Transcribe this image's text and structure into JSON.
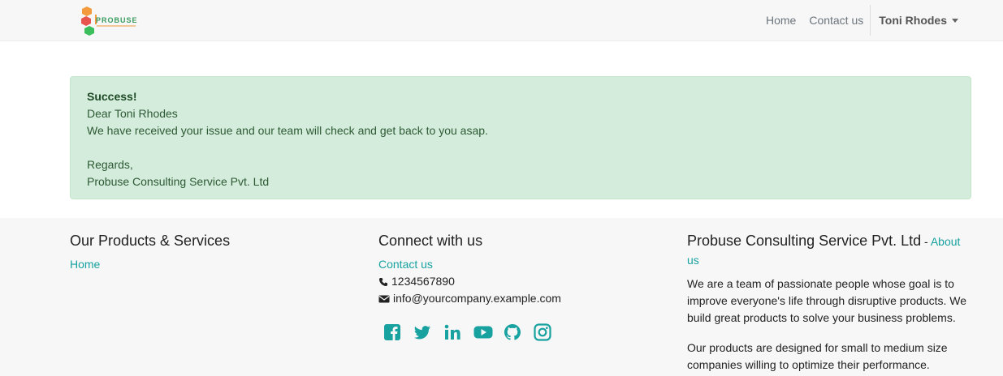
{
  "nav": {
    "brand": "PROBUSE",
    "home": "Home",
    "contact": "Contact us",
    "user": "Toni Rhodes"
  },
  "alert": {
    "title": "Success!",
    "greeting": "Dear Toni Rhodes",
    "message": "We have received your issue and our team will check and get back to you asap.",
    "regards": "Regards,",
    "company": "Probuse Consulting Service Pvt. Ltd"
  },
  "footer": {
    "products_title": "Our Products & Services",
    "products_home": "Home",
    "connect_title": "Connect with us",
    "contact_link": "Contact us",
    "phone": "1234567890",
    "email": "info@yourcompany.example.com",
    "social_icons": [
      "facebook-icon",
      "twitter-icon",
      "linkedin-icon",
      "youtube-icon",
      "github-icon",
      "instagram-icon"
    ],
    "about_company": "Probuse Consulting Service Pvt. Ltd",
    "about_sep": " - ",
    "about_link": "About us",
    "about_p1": "We are a team of passionate people whose goal is to improve everyone's life through disruptive products. We build great products to solve your business problems.",
    "about_p2": "Our products are designed for small to medium size companies willing to optimize their performance."
  },
  "colors": {
    "accent": "#17a2a0",
    "alert_bg": "#d4ecdb",
    "navbar_bg": "#f7f7f7"
  }
}
